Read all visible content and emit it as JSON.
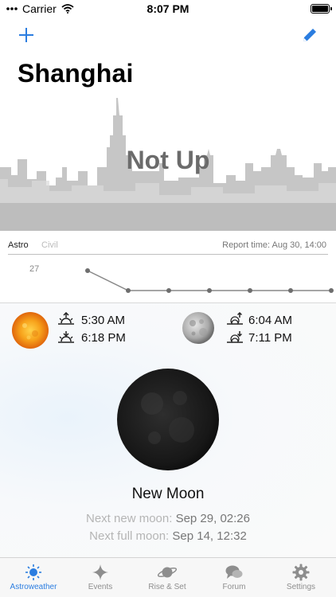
{
  "status": {
    "carrier": "Carrier",
    "time": "8:07 PM"
  },
  "nav": {
    "add_icon": "plus-icon",
    "edit_icon": "pencil-icon"
  },
  "city": {
    "name": "Shanghai",
    "state_label": "Not Up"
  },
  "chart_header": {
    "tab_astro": "Astro",
    "tab_civil": "Civil",
    "report_time": "Report time: Aug 30, 14:00"
  },
  "chart_data": {
    "type": "line",
    "y_label_value": "27",
    "points": [
      27,
      0,
      0,
      0,
      0,
      0,
      0
    ]
  },
  "sun": {
    "rise": "5:30 AM",
    "set": "6:18 PM"
  },
  "moon": {
    "rise": "6:04 AM",
    "set": "7:11 PM"
  },
  "moon_phase": {
    "name": "New Moon",
    "next_new_label": "Next new moon:",
    "next_new_value": "Sep 29, 02:26",
    "next_full_label": "Next full moon:",
    "next_full_value": "Sep 14, 12:32"
  },
  "tabs": [
    {
      "label": "Astroweather",
      "icon": "sun-icon",
      "active": true
    },
    {
      "label": "Events",
      "icon": "star-icon"
    },
    {
      "label": "Rise & Set",
      "icon": "planet-icon"
    },
    {
      "label": "Forum",
      "icon": "chat-icon"
    },
    {
      "label": "Settings",
      "icon": "gear-icon"
    }
  ],
  "colors": {
    "accent": "#2b7de0",
    "skyline": "#c8c8c8",
    "muted": "#b5b5b5"
  }
}
